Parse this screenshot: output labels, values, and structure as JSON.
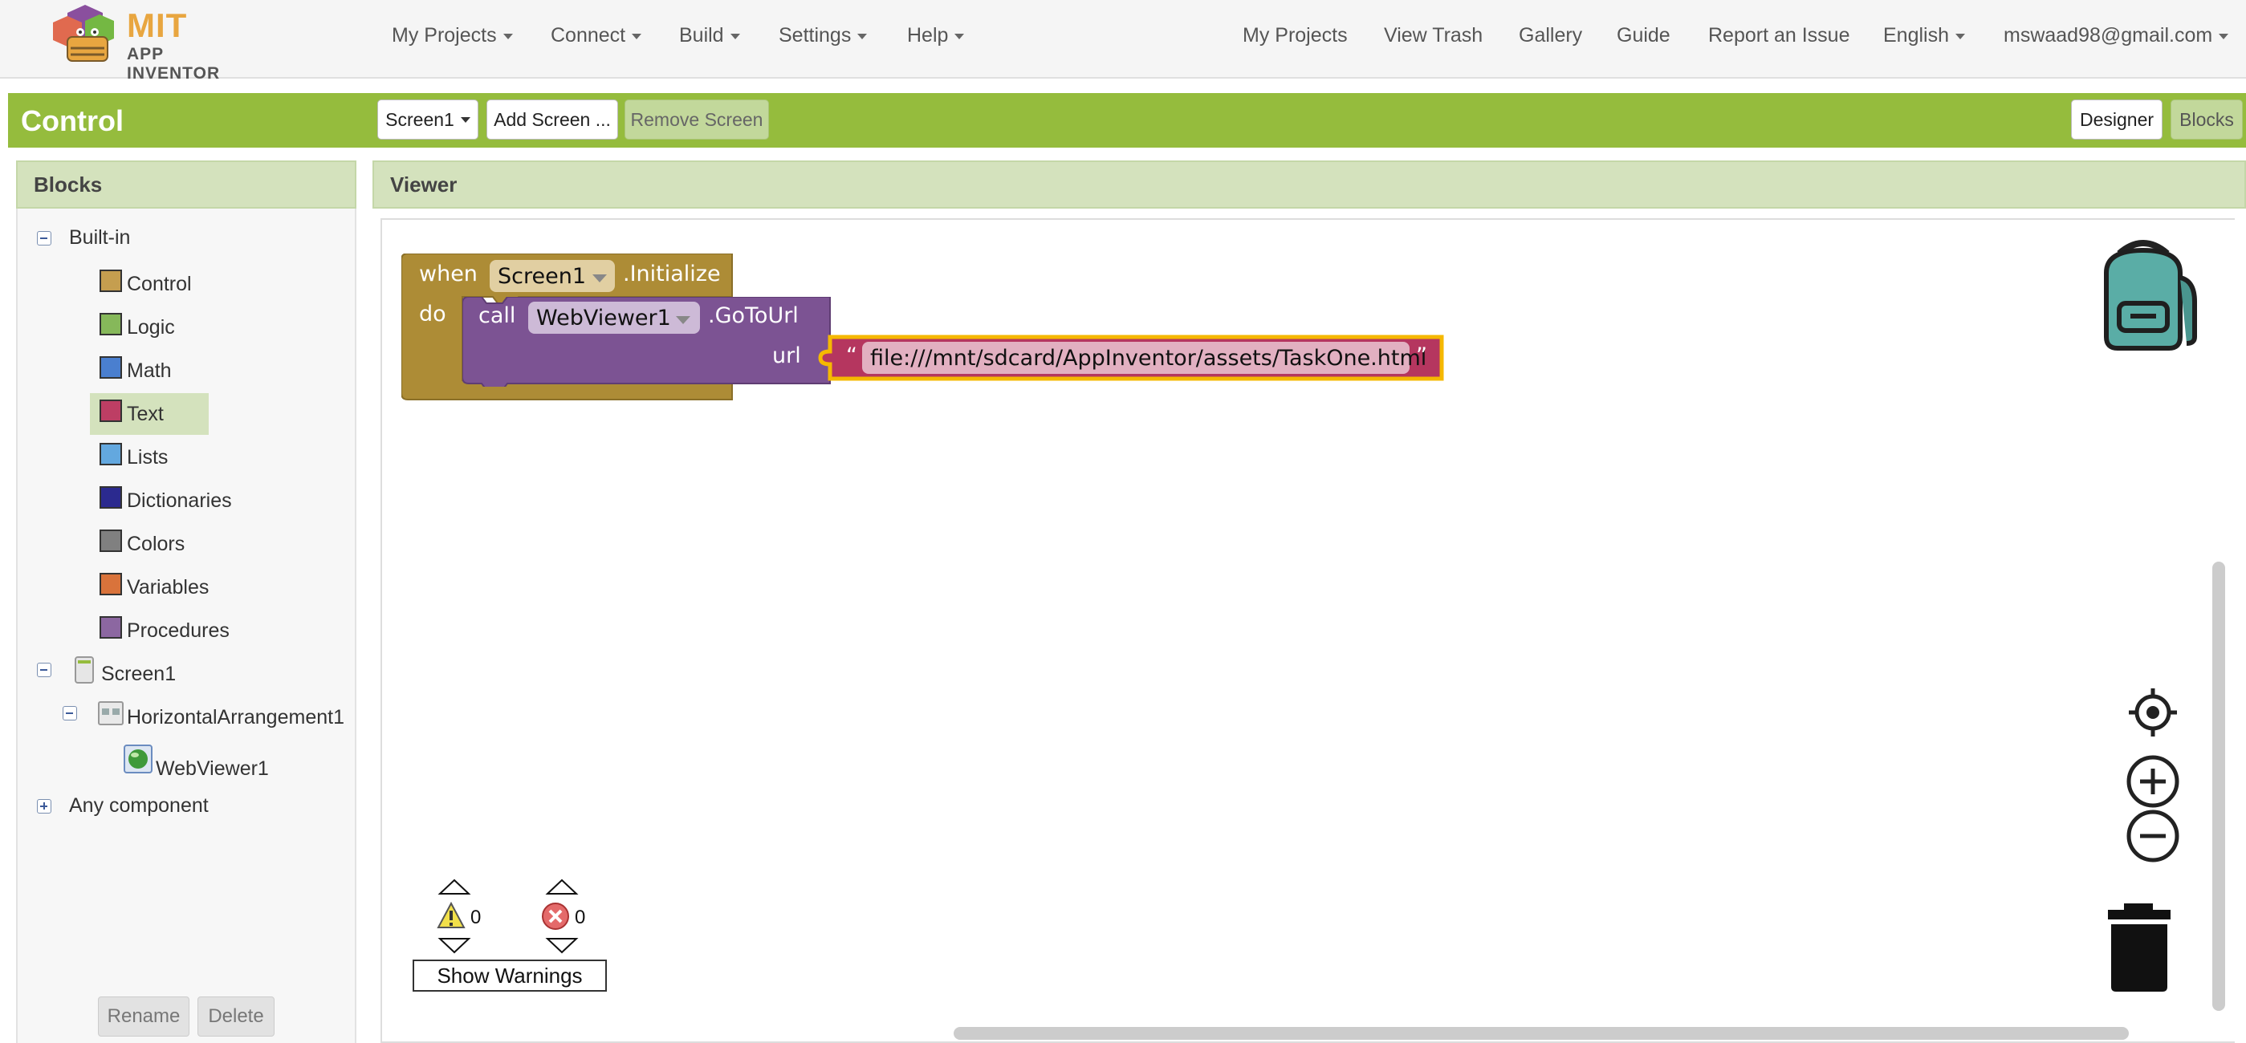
{
  "app": {
    "logo_mit": "MIT",
    "logo_sub": "APP INVENTOR"
  },
  "nav_left": [
    {
      "label": "My Projects"
    },
    {
      "label": "Connect"
    },
    {
      "label": "Build"
    },
    {
      "label": "Settings"
    },
    {
      "label": "Help"
    }
  ],
  "nav_right": {
    "my_projects": "My Projects",
    "view_trash": "View Trash",
    "gallery": "Gallery",
    "guide": "Guide",
    "report": "Report an Issue",
    "language": "English",
    "account": "mswaad98@gmail.com"
  },
  "project": {
    "name": "Control",
    "screen_select": "Screen1",
    "add_screen": "Add Screen ...",
    "remove_screen": "Remove Screen",
    "designer": "Designer",
    "blocks": "Blocks"
  },
  "blocks_panel": {
    "title": "Blocks",
    "builtin": "Built-in",
    "categories": [
      {
        "label": "Control",
        "color": "#c59e4f"
      },
      {
        "label": "Logic",
        "color": "#86b85a"
      },
      {
        "label": "Math",
        "color": "#4a7fcf"
      },
      {
        "label": "Text",
        "color": "#bd3e64"
      },
      {
        "label": "Lists",
        "color": "#63a8df"
      },
      {
        "label": "Dictionaries",
        "color": "#2b2a8f"
      },
      {
        "label": "Colors",
        "color": "#808080"
      },
      {
        "label": "Variables",
        "color": "#d9733b"
      },
      {
        "label": "Procedures",
        "color": "#8c67a1"
      }
    ],
    "screen": "Screen1",
    "arrangement": "HorizontalArrangement1",
    "webviewer": "WebViewer1",
    "any_component": "Any component",
    "rename": "Rename",
    "delete": "Delete"
  },
  "viewer": {
    "title": "Viewer",
    "event_block": {
      "when": "when",
      "component": "Screen1",
      "event": ".Initialize",
      "do": "do",
      "color": "#ad8c36"
    },
    "call_block": {
      "call": "call",
      "component": "WebViewer1",
      "method": ".GoToUrl",
      "param": "url",
      "color": "#7c5393"
    },
    "text_block": {
      "open_quote": "“",
      "value": "file:///mnt/sdcard/AppInventor/assets/TaskOne.html",
      "close_quote": "”",
      "color": "#b5365f",
      "highlight": "#f5b800"
    },
    "warning_count": "0",
    "error_count": "0",
    "show_warnings": "Show Warnings"
  }
}
